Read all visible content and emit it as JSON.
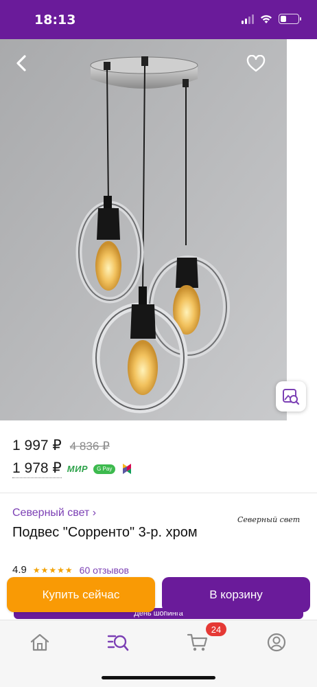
{
  "status_bar": {
    "time": "18:13",
    "icons": [
      "signal-icon",
      "wifi-icon",
      "battery-icon"
    ],
    "background": "#6a1b9a"
  },
  "hero": {
    "icons": [
      "back-arrow-icon",
      "heart-icon",
      "share-icon",
      "visual-search-icon"
    ]
  },
  "price": {
    "current": "1 997 ₽",
    "old": "4 836 ₽",
    "card": "1 978 ₽",
    "payment_mir": "МИР",
    "payment_gpay": "G Pay"
  },
  "seller": {
    "link": "Северный свет ›",
    "logo_text": "Северный свет"
  },
  "product": {
    "title": "Подвес \"Сорренто\" 3-р. хром",
    "rating": "4.9",
    "stars": "★★★★★",
    "rating_value": 4.9,
    "reviews": "60 отзывов"
  },
  "actions": {
    "buy_now": "Купить сейчас",
    "add_to_cart": "В корзину",
    "promo": "День шопинга",
    "buy_color": "#f99a05",
    "cart_color": "#6a1b9a"
  },
  "tab_bar": {
    "tabs": [
      "home-icon",
      "catalog-search-icon",
      "cart-icon",
      "profile-icon"
    ],
    "active": "catalog-search-icon",
    "cart_badge": "24",
    "accent": "#7b3fb4"
  }
}
